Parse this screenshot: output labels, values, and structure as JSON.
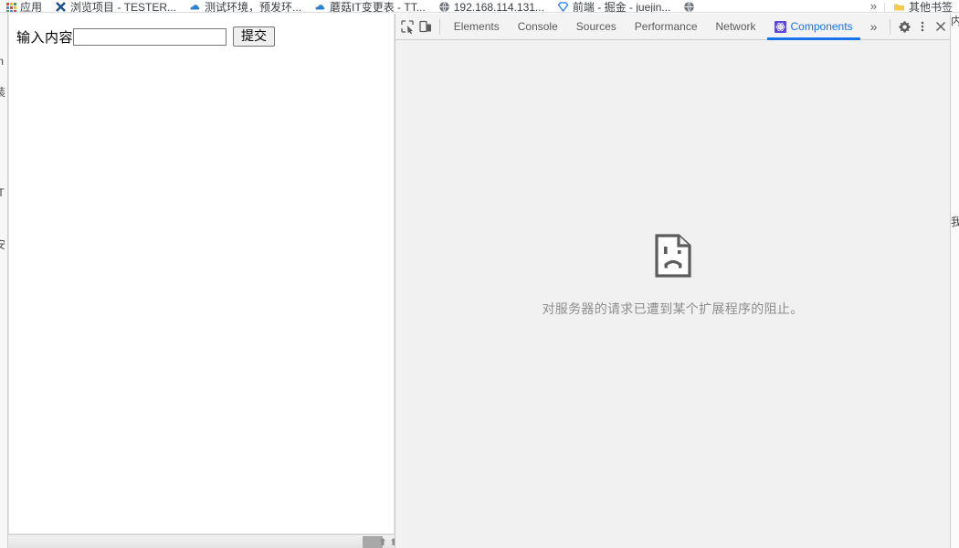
{
  "browser": {
    "bookmarks_bar": {
      "items": [
        {
          "label": "应用",
          "icon": "apps-grid-icon"
        },
        {
          "label": "浏览项目 - TESTER...",
          "icon": "x-favicon"
        },
        {
          "label": "测试环境，预发环...",
          "icon": "cloud-favicon"
        },
        {
          "label": "蘑菇IT变更表 - TT...",
          "icon": "cloud-favicon"
        },
        {
          "label": "192.168.114.131...",
          "icon": "globe-favicon"
        },
        {
          "label": "前端 - 掘金 - juejin...",
          "icon": "diamond-favicon"
        },
        {
          "label": "",
          "icon": "globe-favicon"
        }
      ],
      "overflow_label": "»",
      "other_bookmarks": {
        "label": "其他书签",
        "icon": "folder-icon"
      }
    }
  },
  "page": {
    "form": {
      "label": "输入内容",
      "input_value": "",
      "input_placeholder": "",
      "submit_label": "提交"
    }
  },
  "devtools": {
    "toolbar": {
      "inspect_icon": "inspect-element-icon",
      "device_icon": "device-toolbar-icon",
      "more_tabs_label": "»",
      "settings_icon": "gear-icon",
      "menu_icon": "kebab-menu-icon",
      "close_icon": "close-icon"
    },
    "tabs": [
      {
        "label": "Elements",
        "active": false
      },
      {
        "label": "Console",
        "active": false
      },
      {
        "label": "Sources",
        "active": false
      },
      {
        "label": "Performance",
        "active": false
      },
      {
        "label": "Network",
        "active": false
      },
      {
        "label": "Components",
        "active": true,
        "icon": "react-logo-icon"
      }
    ],
    "blocked_panel": {
      "icon": "sad-page-icon",
      "message": "对服务器的请求已遭到某个扩展程序的阻止。"
    }
  },
  "colors": {
    "accent": "#1a73e8",
    "react_purple": "#5a49d6",
    "devtools_bg": "#f1f1f1",
    "muted_text": "#8d8d8d"
  },
  "edges": {
    "left_ghost": [
      "m",
      "装",
      "IT",
      "安"
    ],
    "right_ghost": [
      "内容",
      "我"
    ]
  }
}
